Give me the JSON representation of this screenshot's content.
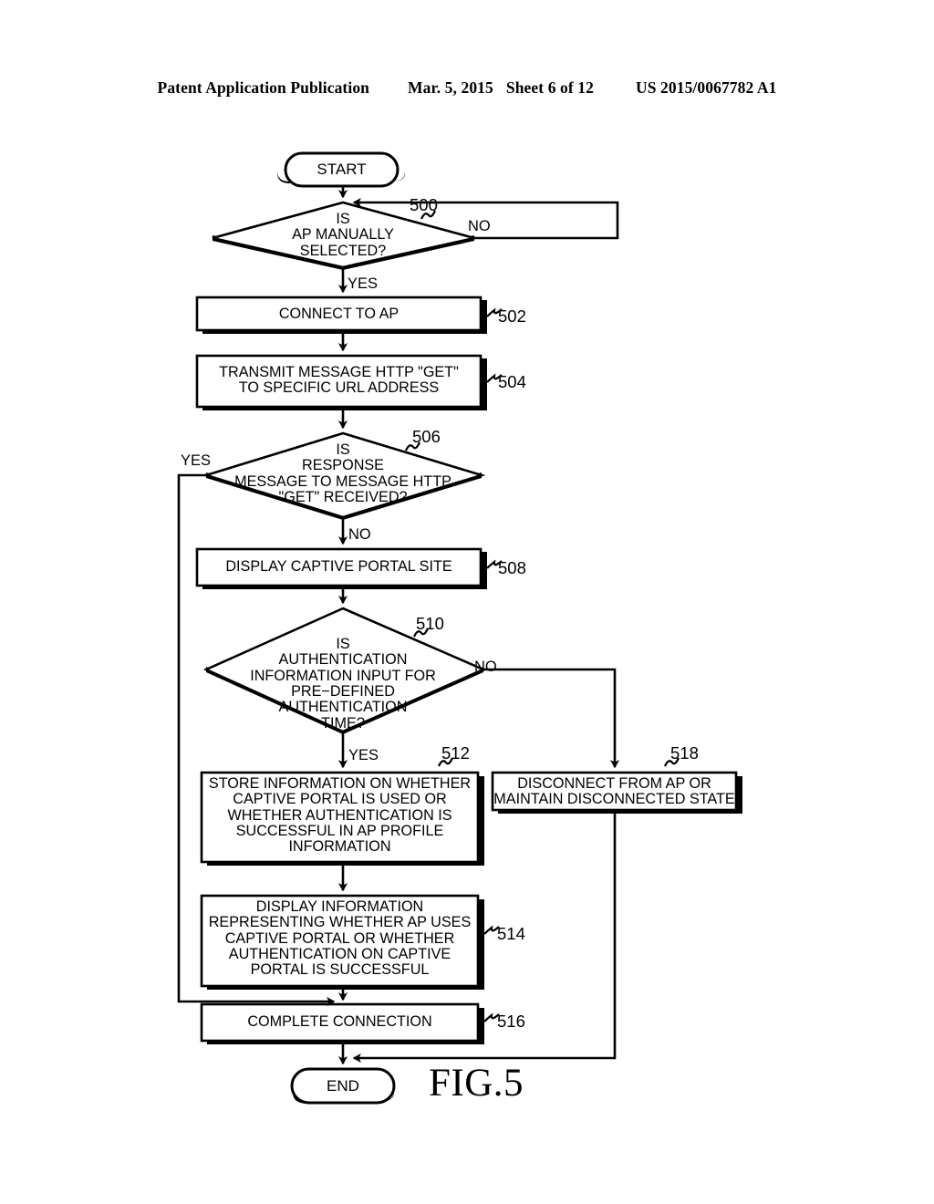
{
  "header": {
    "publication": "Patent Application Publication",
    "date": "Mar. 5, 2015",
    "sheet": "Sheet 6 of 12",
    "pub_number": "US 2015/0067782 A1"
  },
  "figure": {
    "caption": "FIG.5",
    "type": "flowchart",
    "ink_color": "#000000",
    "background": "#ffffff"
  },
  "nodes": {
    "start": {
      "label": "START",
      "shape": "terminal"
    },
    "end": {
      "label": "END",
      "shape": "terminal"
    },
    "d500": {
      "ref": "500",
      "label": "IS\nAP MANUALLY\nSELECTED?",
      "shape": "decision"
    },
    "p502": {
      "ref": "502",
      "label": "CONNECT TO AP",
      "shape": "process"
    },
    "p504": {
      "ref": "504",
      "label": "TRANSMIT MESSAGE HTTP \"GET\"\nTO SPECIFIC URL ADDRESS",
      "shape": "process"
    },
    "d506": {
      "ref": "506",
      "label": "IS\nRESPONSE\nMESSAGE TO MESSAGE HTTP\n\"GET\" RECEIVED?",
      "shape": "decision"
    },
    "p508": {
      "ref": "508",
      "label": "DISPLAY CAPTIVE PORTAL SITE",
      "shape": "process"
    },
    "d510": {
      "ref": "510",
      "label": "IS\nAUTHENTICATION\nINFORMATION INPUT FOR\nPRE−DEFINED\nAUTHENTICATION\nTIME?",
      "shape": "decision"
    },
    "p512": {
      "ref": "512",
      "label": "STORE INFORMATION ON WHETHER\nCAPTIVE PORTAL IS USED OR\nWHETHER AUTHENTICATION IS\nSUCCESSFUL IN AP PROFILE\nINFORMATION",
      "shape": "process"
    },
    "p514": {
      "ref": "514",
      "label": "DISPLAY INFORMATION\nREPRESENTING WHETHER AP USES\nCAPTIVE PORTAL OR WHETHER\nAUTHENTICATION ON CAPTIVE\nPORTAL IS SUCCESSFUL",
      "shape": "process"
    },
    "p516": {
      "ref": "516",
      "label": "COMPLETE CONNECTION",
      "shape": "process"
    },
    "p518": {
      "ref": "518",
      "label": "DISCONNECT FROM AP OR\nMAINTAIN DISCONNECTED STATE",
      "shape": "process"
    }
  },
  "branch_labels": {
    "d500_no": "NO",
    "d500_yes": "YES",
    "d506_yes": "YES",
    "d506_no": "NO",
    "d510_no": "NO",
    "d510_yes": "YES"
  },
  "edges": [
    {
      "from": "start",
      "to": "d500",
      "label": ""
    },
    {
      "from": "d500",
      "to": "d500",
      "label": "NO",
      "note": "loop back to decision 500 input"
    },
    {
      "from": "d500",
      "to": "p502",
      "label": "YES"
    },
    {
      "from": "p502",
      "to": "p504",
      "label": ""
    },
    {
      "from": "p504",
      "to": "d506",
      "label": ""
    },
    {
      "from": "d506",
      "to": "p516",
      "label": "YES"
    },
    {
      "from": "d506",
      "to": "p508",
      "label": "NO"
    },
    {
      "from": "p508",
      "to": "d510",
      "label": ""
    },
    {
      "from": "d510",
      "to": "p518",
      "label": "NO"
    },
    {
      "from": "d510",
      "to": "p512",
      "label": "YES"
    },
    {
      "from": "p512",
      "to": "p514",
      "label": ""
    },
    {
      "from": "p514",
      "to": "p516",
      "label": ""
    },
    {
      "from": "p516",
      "to": "end",
      "label": ""
    },
    {
      "from": "p518",
      "to": "end",
      "label": ""
    }
  ]
}
